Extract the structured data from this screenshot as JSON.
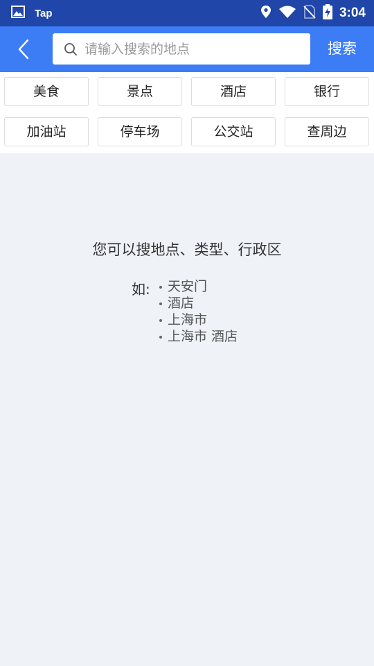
{
  "status_bar": {
    "app_name": "Tap",
    "time": "3:04",
    "icons": [
      "image-icon",
      "location-icon",
      "wifi-icon",
      "no-sim-icon",
      "battery-charging-icon"
    ]
  },
  "header": {
    "back_icon": "chevron-left-icon",
    "search": {
      "placeholder": "请输入搜索的地点",
      "value": ""
    },
    "search_button_label": "搜索"
  },
  "categories": {
    "row1": [
      "美食",
      "景点",
      "酒店",
      "银行"
    ],
    "row2": [
      "加油站",
      "停车场",
      "公交站",
      "查周边"
    ]
  },
  "hint": {
    "title": "您可以搜地点、类型、行政区",
    "example_prefix": "如:",
    "examples": [
      "天安门",
      "酒店",
      "上海市",
      "上海市 酒店"
    ]
  },
  "colors": {
    "status_bar": "#1f46a8",
    "app_bar": "#3c7cf4",
    "background": "#eff2f7"
  }
}
